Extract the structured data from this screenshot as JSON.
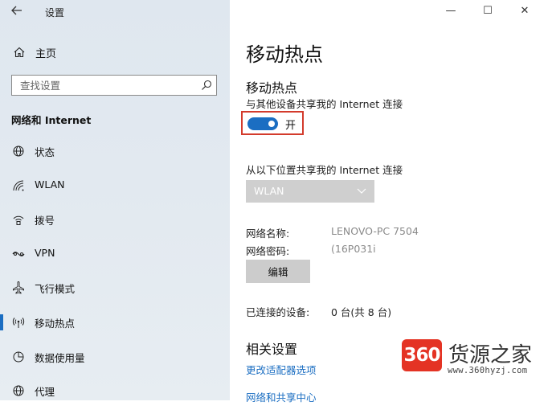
{
  "window": {
    "title": "设置",
    "controls": {
      "minimize": "—",
      "maximize": "☐",
      "close": "✕"
    }
  },
  "sidebar": {
    "home": "主页",
    "search_placeholder": "查找设置",
    "section": "网络和 Internet",
    "items": [
      {
        "label": "状态",
        "icon": "globe-icon"
      },
      {
        "label": "WLAN",
        "icon": "wifi-icon"
      },
      {
        "label": "拨号",
        "icon": "dialup-icon"
      },
      {
        "label": "VPN",
        "icon": "vpn-icon"
      },
      {
        "label": "飞行模式",
        "icon": "airplane-icon"
      },
      {
        "label": "移动热点",
        "icon": "hotspot-icon",
        "active": true
      },
      {
        "label": "数据使用量",
        "icon": "data-usage-icon"
      },
      {
        "label": "代理",
        "icon": "globe-icon"
      }
    ]
  },
  "main": {
    "page_title": "移动热点",
    "section_title": "移动热点",
    "description": "与其他设备共享我的 Internet 连接",
    "toggle": {
      "state_label": "开",
      "on": true
    },
    "share_from_label": "从以下位置共享我的 Internet 连接",
    "share_from_value": "WLAN",
    "network_name_label": "网络名称:",
    "network_name_value": "LENOVO-PC 7504",
    "network_password_label": "网络密码:",
    "network_password_value": "(16P031i",
    "edit_label": "编辑",
    "connected_label": "已连接的设备:",
    "connected_value": "0 台(共 8 台)",
    "related_title": "相关设置",
    "links": [
      "更改适配器选项",
      "网络和共享中心"
    ]
  },
  "watermark": {
    "badge": "360",
    "text": "货源之家",
    "url": "www.360hyzj.com"
  },
  "colors": {
    "accent": "#1b6ec2",
    "highlight_border": "#d33b2c"
  }
}
